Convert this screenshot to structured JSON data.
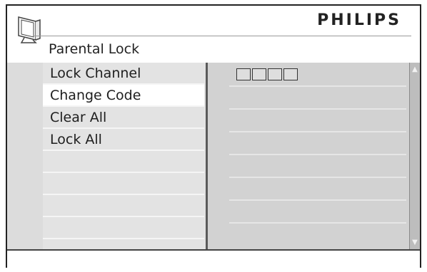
{
  "header": {
    "brand": "PHILIPS",
    "menu_title": "Parental Lock",
    "icon": "tv-icon"
  },
  "menu": {
    "items": [
      {
        "label": "Lock Channel"
      },
      {
        "label": "Change Code"
      },
      {
        "label": "Clear All"
      },
      {
        "label": "Lock All"
      }
    ],
    "selected_index": 1
  },
  "code_entry": {
    "digit_boxes": 4,
    "icons": [
      "empty-digit-box"
    ]
  },
  "scrollbar": {
    "up_icon": "scroll-up-icon",
    "down_icon": "scroll-down-icon"
  },
  "colors": {
    "panel_bg": "#e3e3e3",
    "selected_bg": "#ffffff",
    "right_panel_bg": "#d2d2d2",
    "divider": "#5a5a5a"
  }
}
